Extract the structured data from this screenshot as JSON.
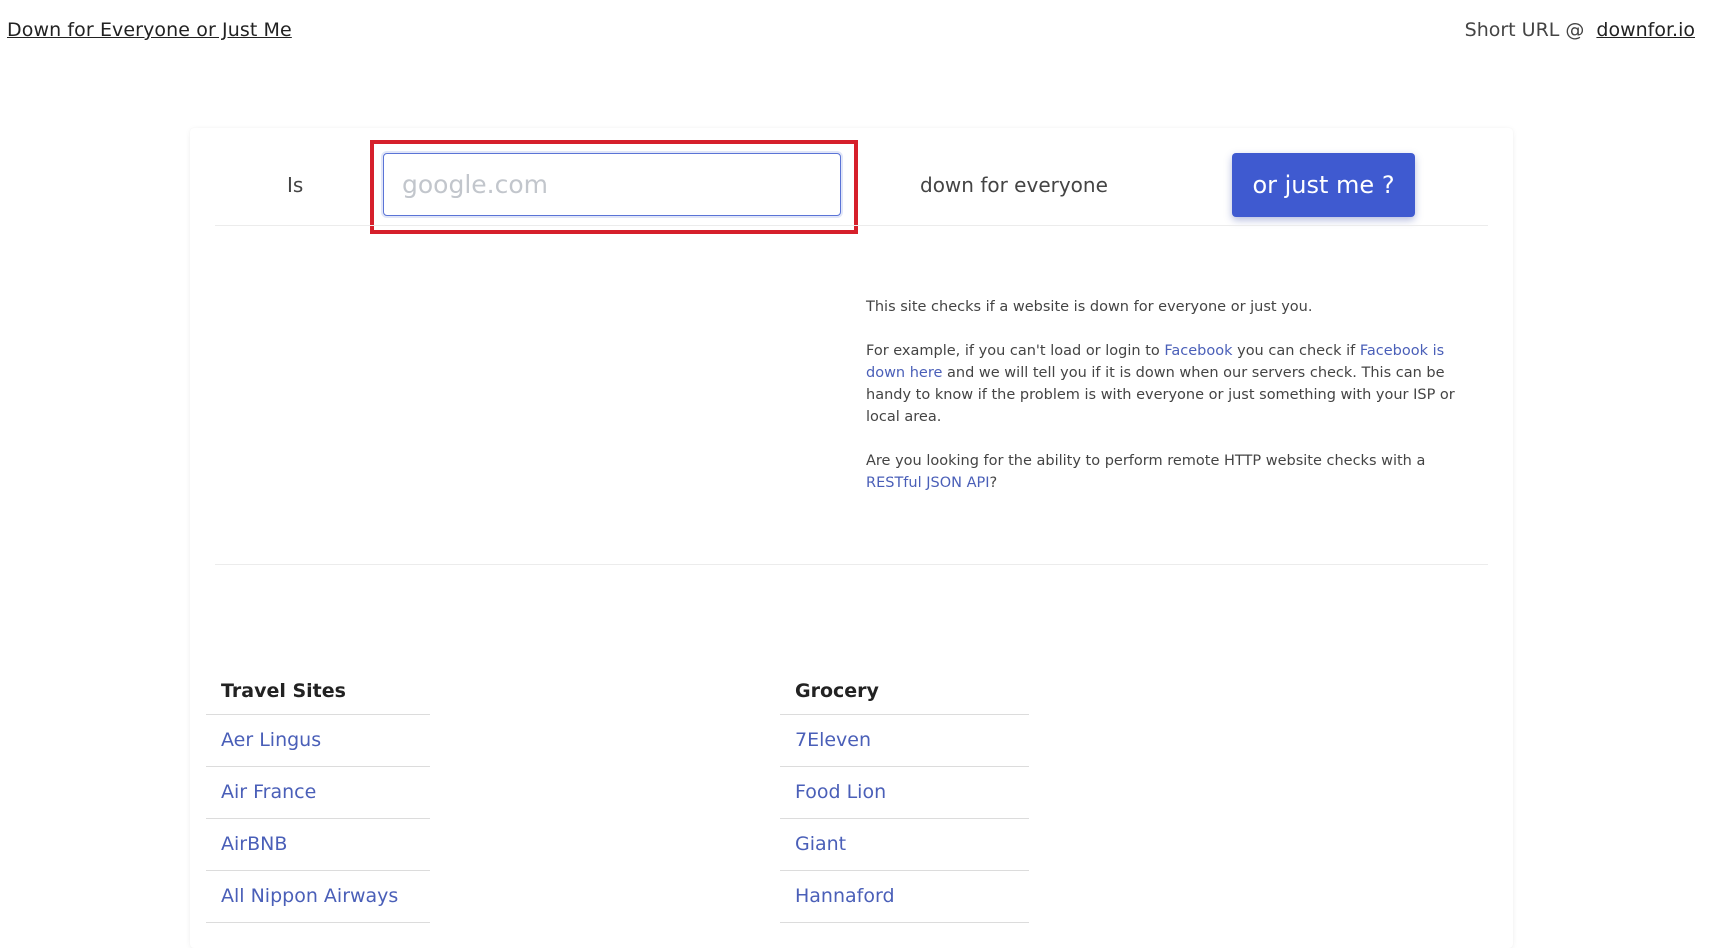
{
  "header": {
    "brand": "Down for Everyone or Just Me",
    "short_url_label": "Short URL @",
    "short_url_link": "downfor.io"
  },
  "search": {
    "prefix": "Is",
    "placeholder": "google.com",
    "value": "",
    "suffix": "down for everyone",
    "button_label": "or just me ?"
  },
  "info": {
    "intro": "This site checks if a website is down for everyone or just you.",
    "example_pre": "For example, if you can't load or login to ",
    "example_link1": "Facebook",
    "example_mid": " you can check if ",
    "example_link2": "Facebook is down here",
    "example_post": " and we will tell you if it is down when our servers check. This can be handy to know if the problem is with everyone or just something with your ISP or local area.",
    "api_pre": "Are you looking for the ability to perform remote HTTP website checks with a ",
    "api_link": "RESTful JSON API",
    "api_post": "?"
  },
  "categories": [
    {
      "title": "Travel Sites",
      "items": [
        "Aer Lingus",
        "Air France",
        "AirBNB",
        "All Nippon Airways"
      ]
    },
    {
      "title": "Grocery",
      "items": [
        "7Eleven",
        "Food Lion",
        "Giant",
        "Hannaford"
      ]
    }
  ],
  "colors": {
    "accent": "#3f5ad0",
    "link": "#4a5fb8",
    "highlight": "#d6202b"
  }
}
